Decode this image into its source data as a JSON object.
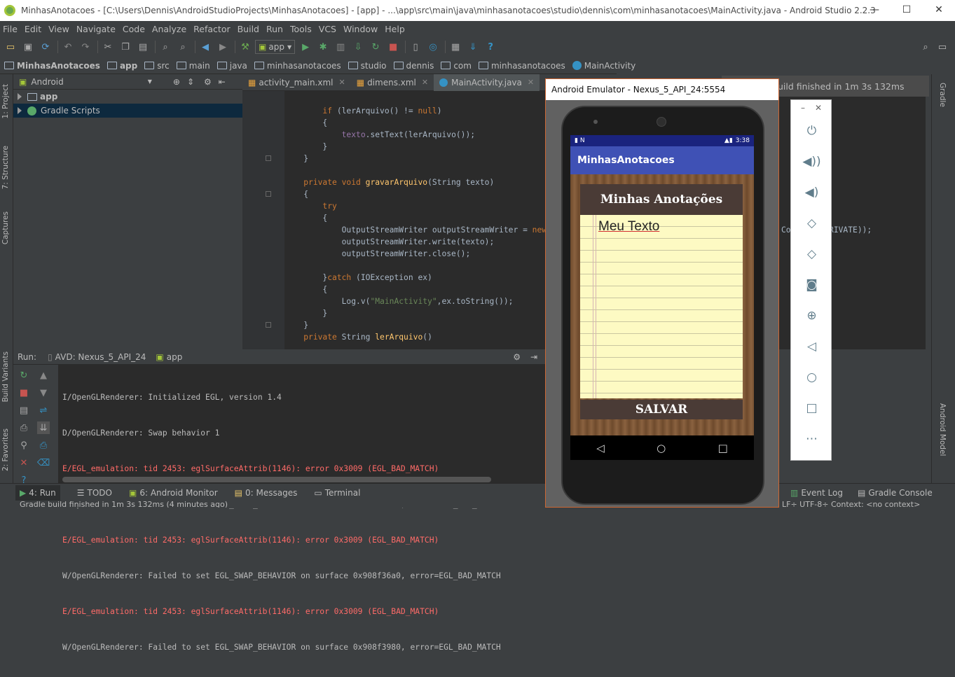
{
  "window": {
    "title": "MinhasAnotacoes - [C:\\Users\\Dennis\\AndroidStudioProjects\\MinhasAnotacoes] - [app] - ...\\app\\src\\main\\java\\minhasanotacoes\\studio\\dennis\\com\\minhasanotacoes\\MainActivity.java - Android Studio 2.2.3",
    "minimize": "—",
    "maximize": "☐",
    "close": "✕"
  },
  "menu": [
    "File",
    "Edit",
    "View",
    "Navigate",
    "Code",
    "Analyze",
    "Refactor",
    "Build",
    "Run",
    "Tools",
    "VCS",
    "Window",
    "Help"
  ],
  "toolbar": {
    "run_config": "app"
  },
  "breadcrumb": [
    "MinhasAnotacoes",
    "app",
    "src",
    "main",
    "java",
    "minhasanotacoes",
    "studio",
    "dennis",
    "com",
    "minhasanotacoes",
    "MainActivity"
  ],
  "project": {
    "view_selector": "Android",
    "items": [
      {
        "label": "app",
        "selected": false
      },
      {
        "label": "Gradle Scripts",
        "selected": true
      }
    ]
  },
  "editor": {
    "tabs": [
      {
        "label": "activity_main.xml",
        "active": false
      },
      {
        "label": "dimens.xml",
        "active": false
      },
      {
        "label": "MainActivity.java",
        "active": true
      }
    ],
    "right_fragment": "Co    DE_PRIVATE));"
  },
  "notification": {
    "text": "uild finished in 1m 3s 132ms"
  },
  "left_tabs": [
    "1: Project",
    "7: Structure",
    "Captures",
    "Build Variants",
    "2: Favorites"
  ],
  "right_tabs": [
    "Gradle",
    "Android Model"
  ],
  "run": {
    "label": "Run:",
    "tabs": [
      "AVD: Nexus_5_API_24",
      "app"
    ],
    "log": [
      {
        "level": "info",
        "text": "I/OpenGLRenderer: Initialized EGL, version 1.4"
      },
      {
        "level": "info",
        "text": "D/OpenGLRenderer: Swap behavior 1"
      },
      {
        "level": "err",
        "text": "E/EGL_emulation: tid 2453: eglSurfaceAttrib(1146): error 0x3009 (EGL_BAD_MATCH)"
      },
      {
        "level": "info",
        "text": "W/OpenGLRenderer: Failed to set EGL_SWAP_BEHAVIOR on surface 0x908f35a0, error=EGL_BAD_MATCH"
      },
      {
        "level": "err",
        "text": "E/EGL_emulation: tid 2453: eglSurfaceAttrib(1146): error 0x3009 (EGL_BAD_MATCH)"
      },
      {
        "level": "info",
        "text": "W/OpenGLRenderer: Failed to set EGL_SWAP_BEHAVIOR on surface 0x908f36a0, error=EGL_BAD_MATCH"
      },
      {
        "level": "err",
        "text": "E/EGL_emulation: tid 2453: eglSurfaceAttrib(1146): error 0x3009 (EGL_BAD_MATCH)"
      },
      {
        "level": "info",
        "text": "W/OpenGLRenderer: Failed to set EGL_SWAP_BEHAVIOR on surface 0x908f3980, error=EGL_BAD_MATCH"
      }
    ]
  },
  "bottom_tabs": [
    {
      "label": "4: Run",
      "active": true
    },
    {
      "label": "TODO",
      "active": false
    },
    {
      "label": "6: Android Monitor",
      "active": false
    },
    {
      "label": "0: Messages",
      "active": false
    },
    {
      "label": "Terminal",
      "active": false
    }
  ],
  "bottom_right_tabs": [
    "Event Log",
    "Gradle Console"
  ],
  "status": {
    "text": "Gradle build finished in 1m 3s 132ms (4 minutes ago)",
    "right": "LF÷  UTF-8÷  Context: <no context>"
  },
  "emulator": {
    "title": "Android Emulator - Nexus_5_API_24:5554",
    "time": "3:38",
    "app_title": "MinhasAnotacoes",
    "note_header": "Minhas Anotações",
    "note_text": "Meu Texto",
    "save_button": "SALVAR",
    "controls": [
      "power",
      "volume-up",
      "volume-down",
      "rotate-left",
      "rotate-right",
      "camera",
      "zoom",
      "back",
      "home",
      "overview",
      "more"
    ]
  }
}
